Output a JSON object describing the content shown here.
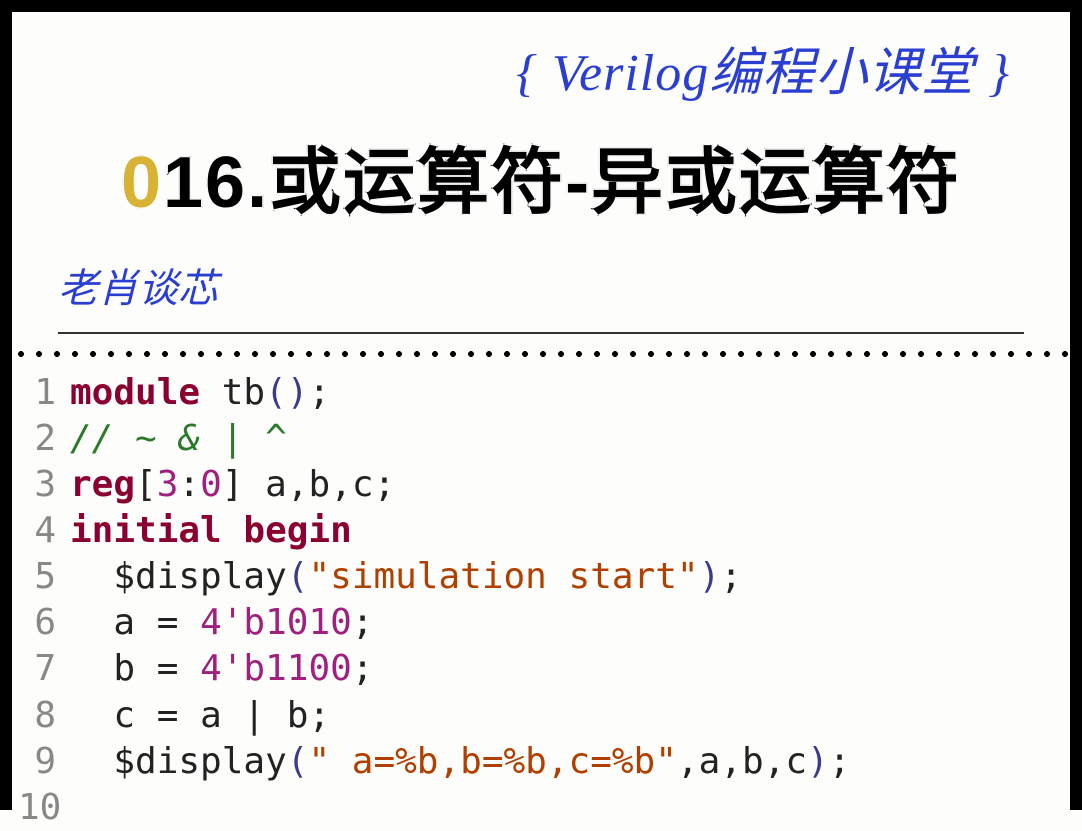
{
  "header": {
    "series_title": "{ Verilog编程小课堂 }",
    "main_title_prefix": "0",
    "main_title_rest": "16.或运算符-异或运算符",
    "author": "老肖谈芯"
  },
  "code": {
    "lines": [
      {
        "n": "1",
        "tokens": [
          {
            "t": "module",
            "c": "kw"
          },
          {
            "t": " tb",
            "c": "ident"
          },
          {
            "t": "()",
            "c": "paren"
          },
          {
            "t": ";",
            "c": "punct"
          }
        ]
      },
      {
        "n": "2",
        "tokens": [
          {
            "t": "// ~ & | ^",
            "c": "comment"
          }
        ]
      },
      {
        "n": "3",
        "tokens": [
          {
            "t": "reg",
            "c": "kw"
          },
          {
            "t": "[",
            "c": "punct"
          },
          {
            "t": "3",
            "c": "num"
          },
          {
            "t": ":",
            "c": "punct"
          },
          {
            "t": "0",
            "c": "num"
          },
          {
            "t": "]",
            "c": "punct"
          },
          {
            "t": " a",
            "c": "ident"
          },
          {
            "t": ",",
            "c": "punct"
          },
          {
            "t": "b",
            "c": "ident"
          },
          {
            "t": ",",
            "c": "punct"
          },
          {
            "t": "c",
            "c": "ident"
          },
          {
            "t": ";",
            "c": "punct"
          }
        ]
      },
      {
        "n": "4",
        "tokens": [
          {
            "t": "initial begin",
            "c": "kw"
          }
        ]
      },
      {
        "n": "5",
        "tokens": [
          {
            "t": "  ",
            "c": "ident"
          },
          {
            "t": "$display",
            "c": "sys"
          },
          {
            "t": "(",
            "c": "paren"
          },
          {
            "t": "\"simulation start\"",
            "c": "str"
          },
          {
            "t": ")",
            "c": "paren"
          },
          {
            "t": ";",
            "c": "punct"
          }
        ]
      },
      {
        "n": "6",
        "tokens": [
          {
            "t": "  a ",
            "c": "ident"
          },
          {
            "t": "=",
            "c": "op"
          },
          {
            "t": " ",
            "c": "ident"
          },
          {
            "t": "4'b1010",
            "c": "num"
          },
          {
            "t": ";",
            "c": "punct"
          }
        ]
      },
      {
        "n": "7",
        "tokens": [
          {
            "t": "  b ",
            "c": "ident"
          },
          {
            "t": "=",
            "c": "op"
          },
          {
            "t": " ",
            "c": "ident"
          },
          {
            "t": "4'b1100",
            "c": "num"
          },
          {
            "t": ";",
            "c": "punct"
          }
        ]
      },
      {
        "n": "8",
        "tokens": [
          {
            "t": "  c ",
            "c": "ident"
          },
          {
            "t": "=",
            "c": "op"
          },
          {
            "t": " a ",
            "c": "ident"
          },
          {
            "t": "|",
            "c": "op"
          },
          {
            "t": " b",
            "c": "ident"
          },
          {
            "t": ";",
            "c": "punct"
          }
        ]
      },
      {
        "n": "9",
        "tokens": [
          {
            "t": "  ",
            "c": "ident"
          },
          {
            "t": "$display",
            "c": "sys"
          },
          {
            "t": "(",
            "c": "paren"
          },
          {
            "t": "\" a=%b,b=%b,c=%b\"",
            "c": "str"
          },
          {
            "t": ",",
            "c": "punct"
          },
          {
            "t": "a",
            "c": "ident"
          },
          {
            "t": ",",
            "c": "punct"
          },
          {
            "t": "b",
            "c": "ident"
          },
          {
            "t": ",",
            "c": "punct"
          },
          {
            "t": "c",
            "c": "ident"
          },
          {
            "t": ")",
            "c": "paren"
          },
          {
            "t": ";",
            "c": "punct"
          }
        ]
      },
      {
        "n": "10",
        "tokens": []
      }
    ]
  }
}
